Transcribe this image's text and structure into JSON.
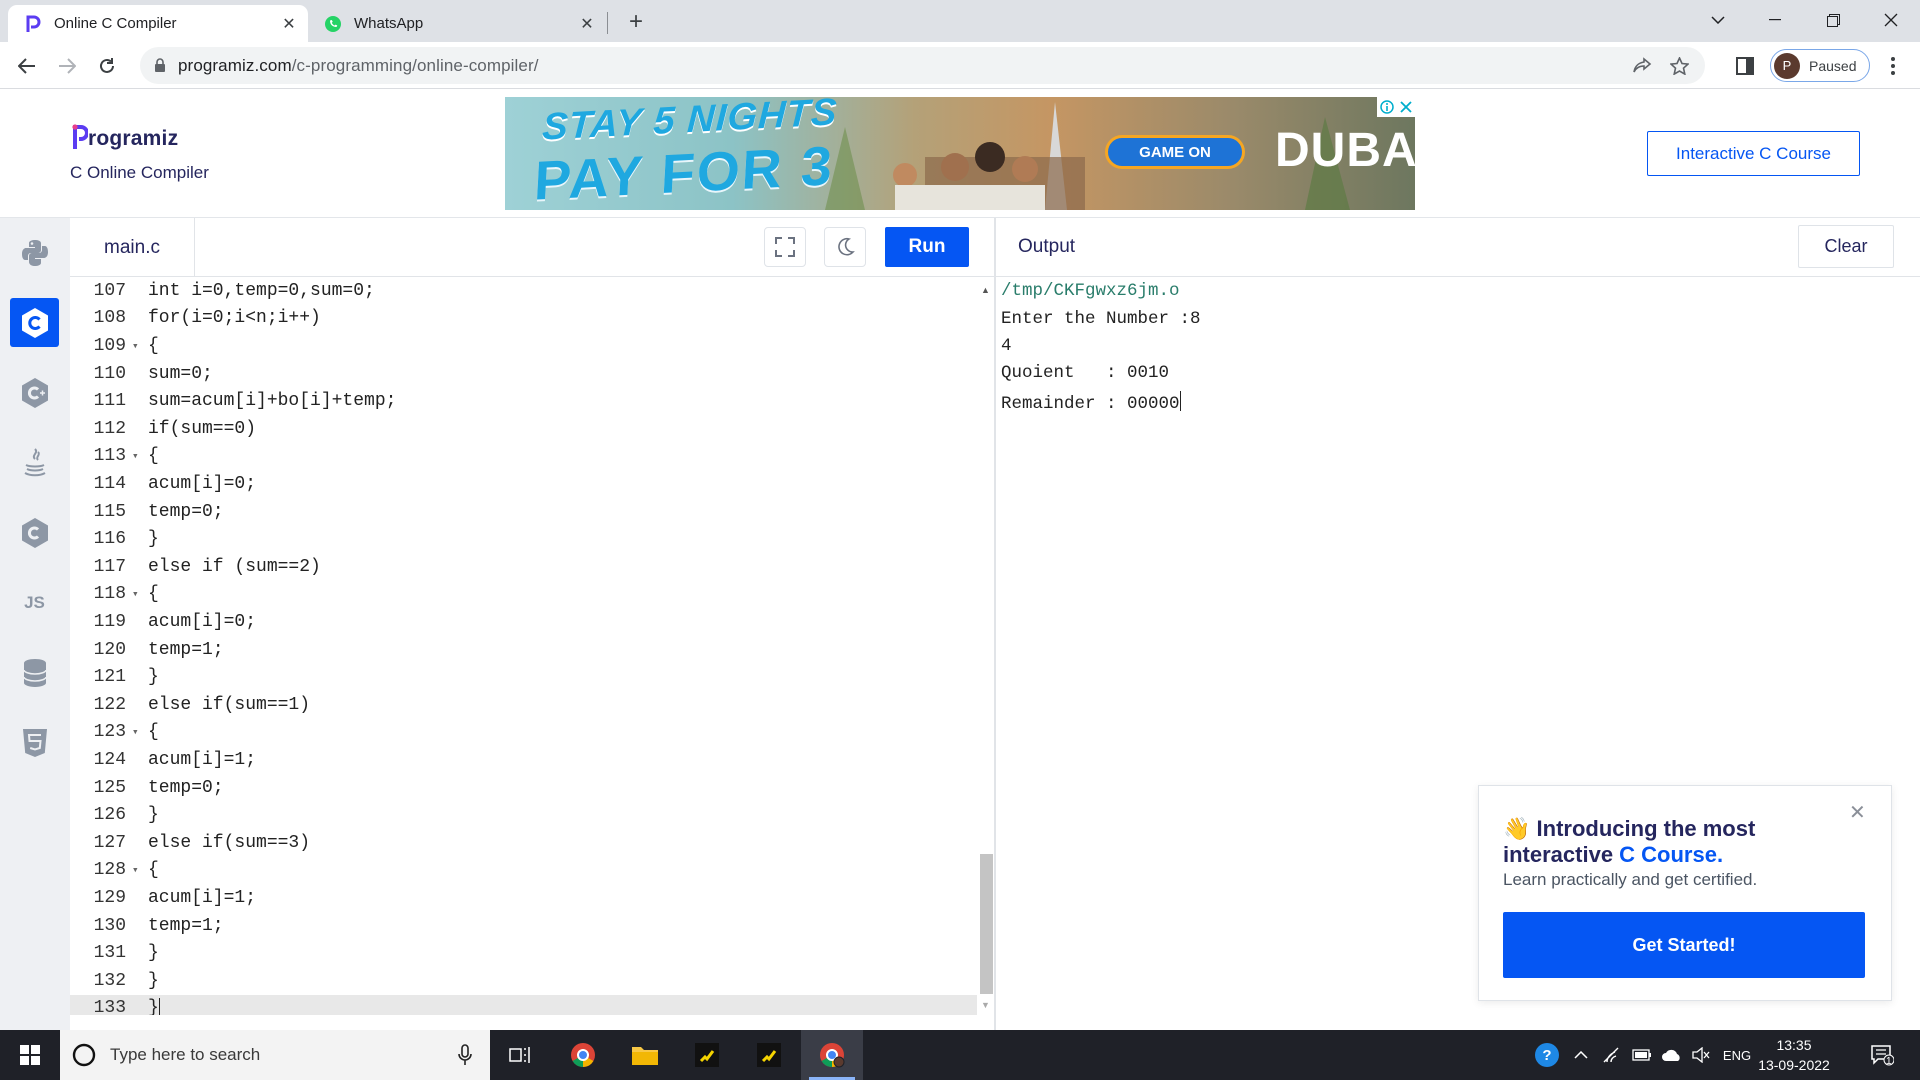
{
  "browser": {
    "tabs": [
      {
        "title": "Online C Compiler",
        "active": true
      },
      {
        "title": "WhatsApp",
        "active": false
      }
    ],
    "url_host": "programiz.com",
    "url_path": "/c-programming/online-compiler/",
    "profile_initial": "P",
    "profile_status": "Paused"
  },
  "header": {
    "logo_text": "rogramiz",
    "subtitle": "C Online Compiler",
    "course_button": "Interactive C Course",
    "ad": {
      "line1": "STAY 5 NIGHTS",
      "line2": "PAY FOR 3",
      "button": "GAME ON",
      "brand": "DUBAI"
    }
  },
  "sidebar": {
    "languages": [
      {
        "name": "python",
        "icon": "python-icon"
      },
      {
        "name": "c",
        "icon": "c-icon",
        "active": true
      },
      {
        "name": "cpp",
        "icon": "cpp-icon"
      },
      {
        "name": "java",
        "icon": "java-icon"
      },
      {
        "name": "csharp",
        "icon": "csharp-icon"
      },
      {
        "name": "javascript",
        "icon": "js-icon",
        "label": "JS"
      },
      {
        "name": "sql",
        "icon": "database-icon"
      },
      {
        "name": "html",
        "icon": "html5-icon"
      }
    ]
  },
  "editor": {
    "filename": "main.c",
    "run_label": "Run",
    "lines": [
      {
        "n": "107",
        "t": "int i=0,temp=0,sum=0;",
        "fold": false
      },
      {
        "n": "108",
        "t": "for(i=0;i<n;i++)",
        "fold": false
      },
      {
        "n": "109",
        "t": "{",
        "fold": true
      },
      {
        "n": "110",
        "t": "sum=0;",
        "fold": false
      },
      {
        "n": "111",
        "t": "sum=acum[i]+bo[i]+temp;",
        "fold": false
      },
      {
        "n": "112",
        "t": "if(sum==0)",
        "fold": false
      },
      {
        "n": "113",
        "t": "{",
        "fold": true
      },
      {
        "n": "114",
        "t": "acum[i]=0;",
        "fold": false
      },
      {
        "n": "115",
        "t": "temp=0;",
        "fold": false
      },
      {
        "n": "116",
        "t": "}",
        "fold": false
      },
      {
        "n": "117",
        "t": "else if (sum==2)",
        "fold": false
      },
      {
        "n": "118",
        "t": "{",
        "fold": true
      },
      {
        "n": "119",
        "t": "acum[i]=0;",
        "fold": false
      },
      {
        "n": "120",
        "t": "temp=1;",
        "fold": false
      },
      {
        "n": "121",
        "t": "}",
        "fold": false
      },
      {
        "n": "122",
        "t": "else if(sum==1)",
        "fold": false
      },
      {
        "n": "123",
        "t": "{",
        "fold": true
      },
      {
        "n": "124",
        "t": "acum[i]=1;",
        "fold": false
      },
      {
        "n": "125",
        "t": "temp=0;",
        "fold": false
      },
      {
        "n": "126",
        "t": "}",
        "fold": false
      },
      {
        "n": "127",
        "t": "else if(sum==3)",
        "fold": false
      },
      {
        "n": "128",
        "t": "{",
        "fold": true
      },
      {
        "n": "129",
        "t": "acum[i]=1;",
        "fold": false
      },
      {
        "n": "130",
        "t": "temp=1;",
        "fold": false
      },
      {
        "n": "131",
        "t": "}",
        "fold": false
      },
      {
        "n": "132",
        "t": "}",
        "fold": false
      },
      {
        "n": "133",
        "t": "}",
        "fold": false,
        "current": true
      }
    ]
  },
  "output": {
    "title": "Output",
    "clear_label": "Clear",
    "lines": [
      "/tmp/CKFgwxz6jm.o",
      "Enter the Number :8",
      "4",
      "Quoient   : 0010",
      "Remainder : 00000"
    ]
  },
  "promo": {
    "emoji": "👋",
    "title_a": "Introducing the most interactive ",
    "title_highlight": "C Course.",
    "subtitle": "Learn practically and get certified.",
    "cta": "Get Started!"
  },
  "taskbar": {
    "search_placeholder": "Type here to search",
    "lang": "ENG",
    "time": "13:35",
    "date": "13-09-2022",
    "notifications": "1"
  },
  "colors": {
    "accent": "#0556f3",
    "brand_text": "#25265e",
    "taskbar": "#1f2128"
  }
}
